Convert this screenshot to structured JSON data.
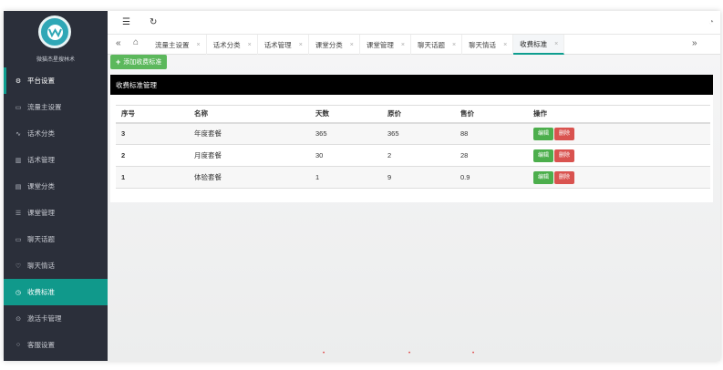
{
  "sidebar": {
    "brand": "微猫杰星搜林术",
    "items": [
      {
        "label": "平台设置",
        "icon": "gear-icon",
        "glyph": "⚙"
      },
      {
        "label": "流量主设置",
        "icon": "video-icon",
        "glyph": "▭"
      },
      {
        "label": "话术分类",
        "icon": "pulse-icon",
        "glyph": "∿"
      },
      {
        "label": "话术管理",
        "icon": "chart-icon",
        "glyph": "▥"
      },
      {
        "label": "课堂分类",
        "icon": "book-icon",
        "glyph": "▤"
      },
      {
        "label": "课堂管理",
        "icon": "list-icon",
        "glyph": "☰"
      },
      {
        "label": "聊天话题",
        "icon": "chat-icon",
        "glyph": "▭"
      },
      {
        "label": "聊天情话",
        "icon": "heart-icon",
        "glyph": "♡"
      },
      {
        "label": "收费标准",
        "icon": "clock-icon",
        "glyph": "◷"
      },
      {
        "label": "激活卡管理",
        "icon": "card-icon",
        "glyph": "⊙"
      },
      {
        "label": "客服设置",
        "icon": "support-icon",
        "glyph": "○"
      }
    ]
  },
  "topbar": {
    "menu_glyph": "☰",
    "refresh_glyph": "↻",
    "right_glyph": "◔"
  },
  "tabbar": {
    "left_glyph": "«",
    "home_glyph": "⌂",
    "right_glyph": "»",
    "tabs": [
      {
        "label": "流量主设置",
        "close": "×"
      },
      {
        "label": "话术分类",
        "close": "×"
      },
      {
        "label": "话术管理",
        "close": "×"
      },
      {
        "label": "课堂分类",
        "close": "×"
      },
      {
        "label": "课堂管理",
        "close": "×"
      },
      {
        "label": "聊天话题",
        "close": "×"
      },
      {
        "label": "聊天情话",
        "close": "×"
      },
      {
        "label": "收费标准",
        "close": "×"
      }
    ]
  },
  "content": {
    "add_button": "添加收费标准",
    "panel_title": "收费标准管理",
    "columns": [
      "序号",
      "名称",
      "天数",
      "原价",
      "售价",
      "操作"
    ],
    "rows": [
      {
        "id": "3",
        "name": "年度套餐",
        "days": "365",
        "original": "365",
        "price": "88"
      },
      {
        "id": "2",
        "name": "月度套餐",
        "days": "30",
        "original": "2",
        "price": "28"
      },
      {
        "id": "1",
        "name": "体验套餐",
        "days": "1",
        "original": "9",
        "price": "0.9"
      }
    ],
    "edit_label": "编辑",
    "delete_label": "删除"
  },
  "colors": {
    "accent": "#10998b",
    "sidebar": "#2b2f3a",
    "edit": "#4cae4c",
    "delete": "#d9534f",
    "add": "#5cb85c"
  }
}
